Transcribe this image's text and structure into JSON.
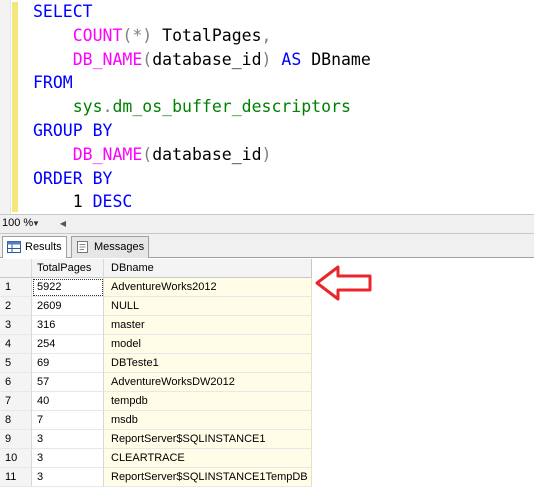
{
  "editor": {
    "lines": [
      [
        {
          "t": "SELECT",
          "c": "kw"
        }
      ],
      [
        {
          "t": "    ",
          "c": "plain"
        },
        {
          "t": "COUNT",
          "c": "fn"
        },
        {
          "t": "(*)",
          "c": "gray"
        },
        {
          "t": " TotalPages",
          "c": "plain"
        },
        {
          "t": ",",
          "c": "gray"
        }
      ],
      [
        {
          "t": "    ",
          "c": "plain"
        },
        {
          "t": "DB_NAME",
          "c": "fn"
        },
        {
          "t": "(",
          "c": "gray"
        },
        {
          "t": "database_id",
          "c": "plain"
        },
        {
          "t": ")",
          "c": "gray"
        },
        {
          "t": " AS",
          "c": "kw"
        },
        {
          "t": " DBname",
          "c": "plain"
        }
      ],
      [
        {
          "t": "FROM",
          "c": "kw"
        }
      ],
      [
        {
          "t": "    ",
          "c": "plain"
        },
        {
          "t": "sys",
          "c": "sys"
        },
        {
          "t": ".",
          "c": "gray"
        },
        {
          "t": "dm_os_buffer_descriptors",
          "c": "sys"
        }
      ],
      [
        {
          "t": "GROUP BY",
          "c": "kw"
        }
      ],
      [
        {
          "t": "    ",
          "c": "plain"
        },
        {
          "t": "DB_NAME",
          "c": "fn"
        },
        {
          "t": "(",
          "c": "gray"
        },
        {
          "t": "database_id",
          "c": "plain"
        },
        {
          "t": ")",
          "c": "gray"
        }
      ],
      [
        {
          "t": "ORDER BY",
          "c": "kw"
        }
      ],
      [
        {
          "t": "    ",
          "c": "plain"
        },
        {
          "t": "1",
          "c": "plain"
        },
        {
          "t": " DESC",
          "c": "kw"
        }
      ]
    ]
  },
  "zoom": {
    "value": "100 %"
  },
  "tabs": {
    "results_label": "Results",
    "messages_label": "Messages"
  },
  "grid": {
    "columns": [
      "TotalPages",
      "DBname"
    ],
    "rows": [
      {
        "n": "1",
        "total": "5922",
        "db": "AdventureWorks2012"
      },
      {
        "n": "2",
        "total": "2609",
        "db": "NULL"
      },
      {
        "n": "3",
        "total": "316",
        "db": "master"
      },
      {
        "n": "4",
        "total": "254",
        "db": "model"
      },
      {
        "n": "5",
        "total": "69",
        "db": "DBTeste1"
      },
      {
        "n": "6",
        "total": "57",
        "db": "AdventureWorksDW2012"
      },
      {
        "n": "7",
        "total": "40",
        "db": "tempdb"
      },
      {
        "n": "8",
        "total": "7",
        "db": "msdb"
      },
      {
        "n": "9",
        "total": "3",
        "db": "ReportServer$SQLINSTANCE1"
      },
      {
        "n": "10",
        "total": "3",
        "db": "CLEARTRACE"
      },
      {
        "n": "11",
        "total": "3",
        "db": "ReportServer$SQLINSTANCE1TempDB"
      }
    ]
  },
  "annotation": {
    "arrow_color": "#e8262b"
  },
  "colors": {
    "keyword": "#0000ff",
    "function": "#ff00ff",
    "operator": "#808080",
    "system_object": "#008000"
  }
}
